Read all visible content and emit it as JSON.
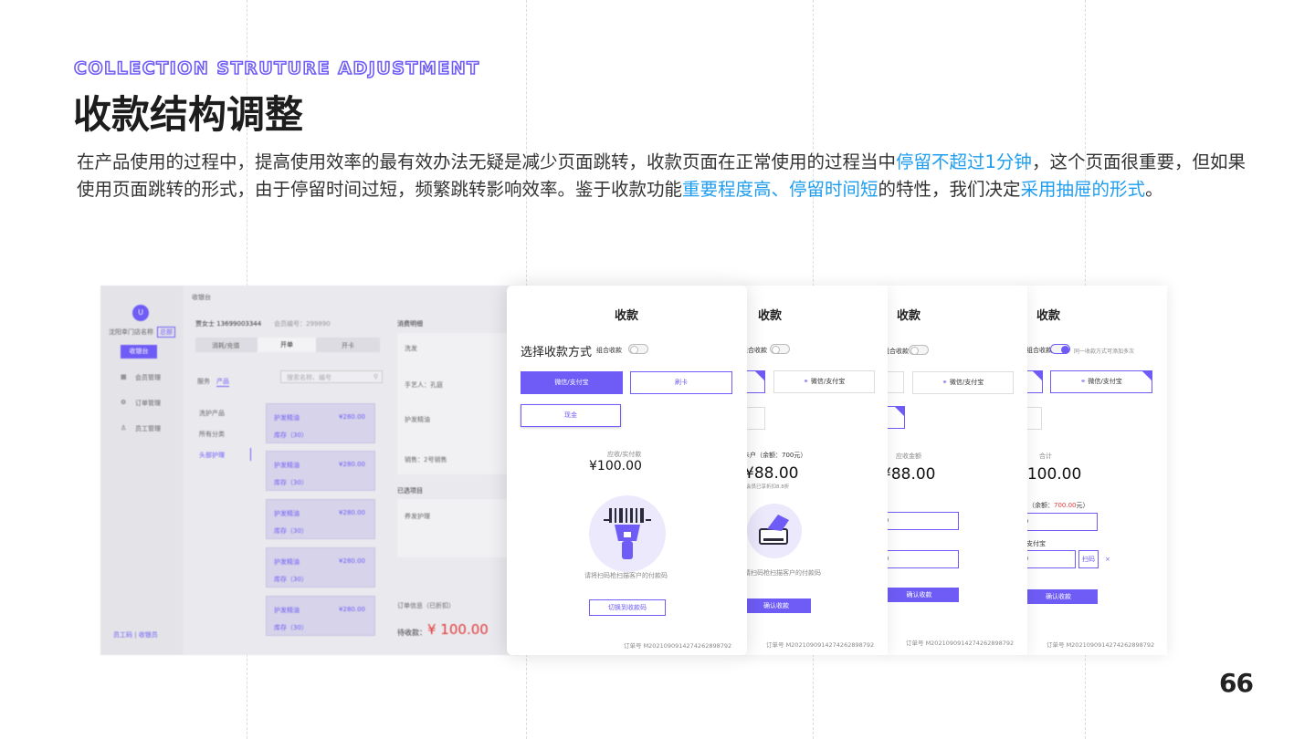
{
  "eyebrow": "COLLECTION STRUTURE ADJUSTMENT",
  "title": "收款结构调整",
  "paragraph": {
    "p1": "在产品使用的过程中，提高使用效率的最有效办法无疑是减少页面跳转，收款页面在正常使用的过程当中",
    "h1": "停留不超过1分钟",
    "p2": "，这个页面很重要，但如果使用页面跳转的形式，由于停留时间过短，频繁跳转影响效率。鉴于收款功能",
    "h2": "重要程度高、停留时间短",
    "p3": "的特性，我们决定",
    "h3": "采用抽屉的形式",
    "p4": "。"
  },
  "page_number": "66",
  "colors": {
    "accent": "#6f5cf6",
    "highlight": "#1f9dee"
  },
  "app": {
    "avatar": "U",
    "store": "沈阳幸门店名称",
    "store_tag": "总部",
    "breadcrumb": "收银台",
    "cashier_btn": "收银台",
    "nav": [
      "会员管理",
      "订单管理",
      "员工管理"
    ],
    "customer": "贾女士  13699003344",
    "member_no": "会员编号：299890",
    "tabs": [
      "消耗/充值",
      "开单",
      "开卡"
    ],
    "sub_tabs": [
      "服务",
      "产品"
    ],
    "search_placeholder": "搜索名称、编号",
    "categories": [
      "洗护产品",
      "所有分类",
      "头部护理"
    ],
    "products": [
      {
        "name": "护发精油",
        "price": "¥280.00",
        "stock": "库存（30）"
      },
      {
        "name": "护发精油",
        "price": "¥280.00",
        "stock": "库存（30）"
      },
      {
        "name": "护发精油",
        "price": "¥280.00",
        "stock": "库存（30）"
      },
      {
        "name": "护发精油",
        "price": "¥280.00",
        "stock": "库存（30）"
      },
      {
        "name": "护发精油",
        "price": "¥280.00",
        "stock": "库存（30）"
      }
    ],
    "detail_title": "消费明细",
    "detail_rows": [
      "洗发",
      "手艺人：孔庭",
      "护发精油",
      "销售：2号销售"
    ],
    "selected_title": "已选项目",
    "selected_item": "养发护理",
    "order_label": "订单信息（已折扣）",
    "due_label": "待收款：",
    "due_amount": "¥ 100.00",
    "footer": "员工码 | 收银员"
  },
  "drawer1": {
    "title": "收款",
    "choose_label": "选择收款方式",
    "combine_label": "组合收款",
    "methods": [
      "微信/支付宝",
      "刷卡",
      "现金"
    ],
    "amount_label": "应收/实付款",
    "amount": "¥100.00",
    "hint": "请将扫码枪扫描客户的付款码",
    "switch_btn": "切换到收款码",
    "order": "订单号  M2021090914274262898792"
  },
  "drawer2": {
    "title": "收款",
    "combine_label": "组合收款",
    "method": "微信/支付宝",
    "balance_label": "卡户（余额：700元）",
    "amount": "¥88.00",
    "member_note": "会员已享折扣8.8折",
    "hint": "请扫码枪扫描客户的付款码",
    "confirm": "确认收款",
    "order": "订单号  M2021090914274262898792"
  },
  "drawer3": {
    "title": "收款",
    "combine_label": "组合收款",
    "method": "微信/支付宝",
    "amount_label": "应收金额",
    "amount": "¥88.00",
    "input1": "0",
    "input2": "0",
    "confirm": "确认收款",
    "order": "订单号  M2021090914274262898792"
  },
  "drawer4": {
    "title": "收款",
    "combine_label": "组合收款",
    "combine_note": "同一收款方式可添加多次",
    "method": "微信/支付宝",
    "total_label": "合计",
    "amount": "¥100.00",
    "balance_label": "（余额：",
    "balance_value": "700.00",
    "balance_unit": "元）",
    "input1": "0",
    "pay_label": "支付宝",
    "input2": "0",
    "scan_btn": "扫码",
    "confirm": "确认收款",
    "order": "订单号  M2021090914274262898792"
  }
}
